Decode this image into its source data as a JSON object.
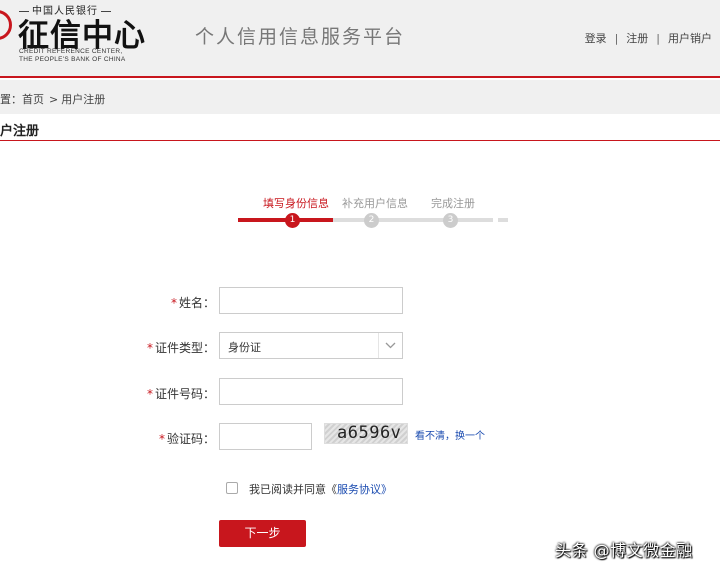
{
  "header": {
    "logo_top": "中国人民银行",
    "logo_cn": "征信中心",
    "logo_en_line1": "CREDIT REFERENCE CENTER,",
    "logo_en_line2": "THE PEOPLE'S BANK OF CHINA",
    "platform_title": "个人信用信息服务平台",
    "links": {
      "login": "登录",
      "register": "注册",
      "cancel_account": "用户销户",
      "separator": "|"
    }
  },
  "breadcrumb": {
    "prefix": "置：",
    "home": "首页",
    "separator": ">",
    "current": "用户注册"
  },
  "section_title": "户注册",
  "steps": [
    {
      "label": "填写身份信息",
      "number": "1",
      "active": true
    },
    {
      "label": "补充用户信息",
      "number": "2",
      "active": false
    },
    {
      "label": "完成注册",
      "number": "3",
      "active": false
    }
  ],
  "form": {
    "required_mark": "*",
    "name": {
      "label": "姓名：",
      "value": ""
    },
    "id_type": {
      "label": "证件类型：",
      "value": "身份证"
    },
    "id_number": {
      "label": "证件号码：",
      "value": ""
    },
    "captcha": {
      "label": "验证码：",
      "value": "",
      "image_text": "a6596v",
      "refresh": "看不清，换一个"
    }
  },
  "agreement": {
    "text": "我已阅读并同意《",
    "link": "服务协议",
    "close": "》",
    "checked": false
  },
  "next_button": "下一步",
  "watermark": "头条 @博文微金融",
  "colors": {
    "accent": "#c8161d",
    "link": "#1a4bb0",
    "header_bg": "#f0f0f0"
  }
}
